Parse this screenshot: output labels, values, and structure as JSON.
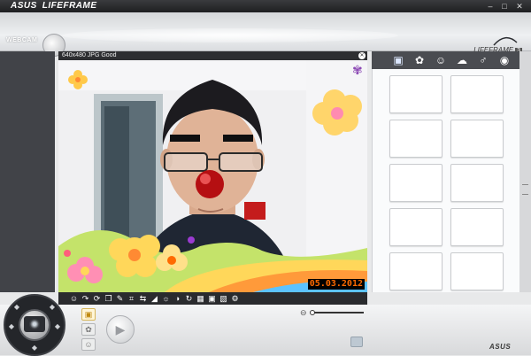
{
  "titlebar": {
    "brand": "ASUS",
    "app_name": "LIFEFRAME",
    "minimize_glyph": "–",
    "maximize_glyph": "□",
    "close_glyph": "✕"
  },
  "header": {
    "mode_label": "WEBCAM",
    "logo_text": "LIFEFRAME",
    "logo_version": "3"
  },
  "video": {
    "resolution_label": "640x480  JPG  Good",
    "timestamp": "05.03.2012",
    "close_glyph": "✕"
  },
  "toolbar": {
    "icons": [
      "person-icon",
      "cursor-icon",
      "rotate-icon",
      "frames-icon",
      "pencil-icon",
      "crop-icon",
      "mirror-icon",
      "triangle-icon",
      "sun-icon",
      "contrast-icon",
      "refresh-icon",
      "grid-icon",
      "camera-icon",
      "picture-icon",
      "settings-icon"
    ],
    "glyphs": [
      "☺",
      "↷",
      "⟳",
      "❐",
      "✎",
      "⌗",
      "⇆",
      "◢",
      "☼",
      "◑",
      "↻",
      "▦",
      "▣",
      "▧",
      "⚙"
    ]
  },
  "panel": {
    "tabs": [
      {
        "name": "camera-tab-icon",
        "glyph": "▣"
      },
      {
        "name": "flower-tab-icon",
        "glyph": "✿"
      },
      {
        "name": "face-tab-icon",
        "glyph": "☺"
      },
      {
        "name": "frame-tab-icon",
        "glyph": "☁"
      },
      {
        "name": "microphone-tab-icon",
        "glyph": "♂"
      },
      {
        "name": "eye-tab-icon",
        "glyph": "◉"
      }
    ],
    "thumbnail_count": 10
  },
  "footer": {
    "mode_buttons": [
      {
        "name": "photo-mode-icon",
        "glyph": "▣"
      },
      {
        "name": "effects-mode-icon",
        "glyph": "✿"
      },
      {
        "name": "face-mode-icon",
        "glyph": "☺"
      }
    ],
    "play_glyph": "▶",
    "zoom_glyph": "⊖",
    "zoom_level": 0.0,
    "logo": "ASUS"
  },
  "colors": {
    "accent": "#ff6a00",
    "dark_bg": "#414348",
    "panel_bg": "#fafbfc"
  }
}
